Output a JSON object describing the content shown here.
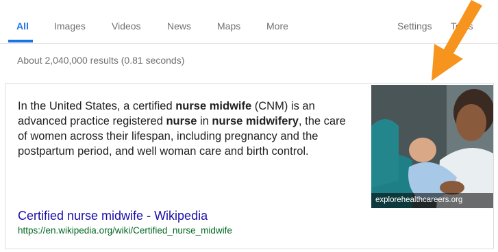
{
  "tabs": [
    {
      "label": "All",
      "active": true
    },
    {
      "label": "Images"
    },
    {
      "label": "Videos"
    },
    {
      "label": "News"
    },
    {
      "label": "Maps"
    },
    {
      "label": "More"
    }
  ],
  "settings_label": "Settings",
  "tools_label": "Tools",
  "result_stats": "About 2,040,000 results (0.81 seconds)",
  "snippet": {
    "t1": "In the United States, a certified ",
    "b1": "nurse midwife",
    "t2": " (CNM) is an advanced practice registered ",
    "b2": "nurse",
    "t3": " in ",
    "b3": "nurse midwifery",
    "t4": ", the care of women across their lifespan, including pregnancy and the postpartum period, and well woman care and birth control."
  },
  "result": {
    "title": "Certified nurse midwife - Wikipedia",
    "url": "https://en.wikipedia.org/wiki/Certified_nurse_midwife"
  },
  "image": {
    "caption": "explorehealthcareers.org"
  },
  "colors": {
    "accent": "#1a73e8",
    "link": "#1a0dab",
    "url": "#006621",
    "arrow": "#f7941d"
  }
}
